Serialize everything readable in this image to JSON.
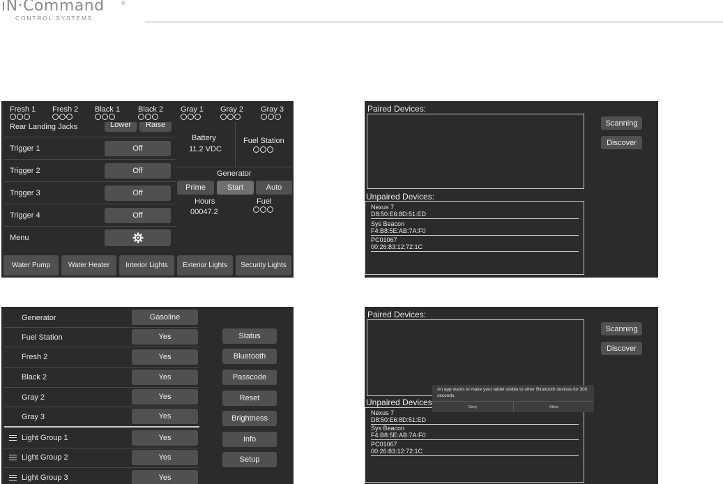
{
  "header": {
    "logo_main": "ıN·Command",
    "logo_reg": "®",
    "logo_sub": "CONTROL SYSTEMS"
  },
  "status_panel": {
    "tanks": [
      {
        "label": "Fresh 1"
      },
      {
        "label": "Fresh 2"
      },
      {
        "label": "Black 1"
      },
      {
        "label": "Black 2"
      },
      {
        "label": "Gray 1"
      },
      {
        "label": "Gray 2"
      },
      {
        "label": "Gray 3"
      }
    ],
    "partial_row": {
      "label": "Rear Landing Jacks",
      "lower": "Lower",
      "raise": "Raise"
    },
    "rows": [
      {
        "label": "Trigger 1",
        "value": "Off"
      },
      {
        "label": "Trigger 2",
        "value": "Off"
      },
      {
        "label": "Trigger 3",
        "value": "Off"
      },
      {
        "label": "Trigger 4",
        "value": "Off"
      }
    ],
    "menu_label": "Menu",
    "battery_label": "Battery",
    "battery_value": "11.2 VDC",
    "fuel_station_label": "Fuel Station",
    "generator_label": "Generator",
    "gen_prime": "Prime",
    "gen_start": "Start",
    "gen_auto": "Auto",
    "hours_label": "Hours",
    "hours_value": "00047.2",
    "fuel_label": "Fuel",
    "bottom_buttons": [
      "Water Pump",
      "Water Heater",
      "Interior Lights",
      "Exterior Lights",
      "Security Lights"
    ]
  },
  "bt_panel_1": {
    "paired_title": "Paired Devices:",
    "unpaired_title": "Unpaired Devices:",
    "scanning": "Scanning",
    "discover": "Discover",
    "devices": [
      {
        "name": "Nexus 7",
        "mac": "D8:50:E6:8D:51:ED"
      },
      {
        "name": "Sys Beacon",
        "mac": "F4:B8:5E:AB:7A:F0"
      },
      {
        "name": "PC01067",
        "mac": "00:26:83:12:72:1C"
      }
    ]
  },
  "settings_panel": {
    "rows": [
      {
        "label": "Generator",
        "value": "Gasoline"
      },
      {
        "label": "Fuel Station",
        "value": "Yes"
      },
      {
        "label": "Fresh 2",
        "value": "Yes"
      },
      {
        "label": "Black 2",
        "value": "Yes"
      },
      {
        "label": "Gray 2",
        "value": "Yes"
      },
      {
        "label": "Gray 3",
        "value": "Yes"
      }
    ],
    "group_rows": [
      {
        "label": "Light Group 1",
        "value": "Yes"
      },
      {
        "label": "Light Group 2",
        "value": "Yes"
      },
      {
        "label": "Light Group 3",
        "value": "Yes"
      }
    ],
    "side_buttons": [
      "Status",
      "Bluetooth",
      "Passcode",
      "Reset",
      "Brightness",
      "Info",
      "Setup"
    ]
  },
  "bt_panel_2": {
    "paired_title": "Paired Devices:",
    "unpaired_title": "Unpaired Devices:",
    "scanning": "Scanning",
    "discover": "Discover",
    "dialog_text": "An app wants to make your tablet visible to other Bluetooth devices for 300 seconds.",
    "deny": "Deny",
    "allow": "Allow",
    "devices": [
      {
        "name": "Nexus 7",
        "mac": "D8:50:E6:8D:51:ED"
      },
      {
        "name": "Sys Beacon",
        "mac": "F4:B8:5E:AB:7A:F0"
      },
      {
        "name": "PC01067",
        "mac": "00:26:83:12:72:1C"
      }
    ]
  }
}
